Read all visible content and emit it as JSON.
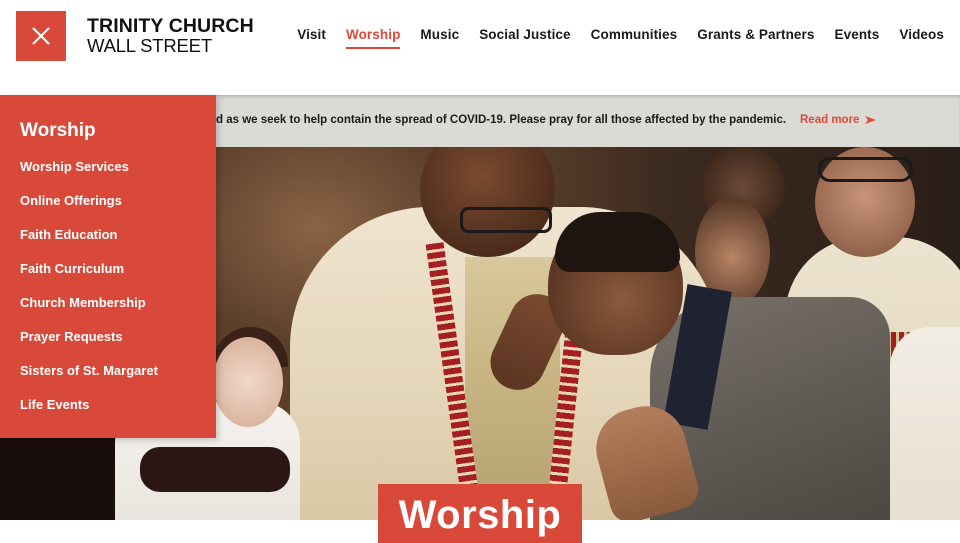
{
  "header": {
    "menu_close_icon": "close-icon",
    "logo": {
      "line1": "TRINITY CHURCH",
      "line2": "WALL STREET"
    },
    "nav": [
      {
        "label": "Visit",
        "active": false
      },
      {
        "label": "Worship",
        "active": true
      },
      {
        "label": "Music",
        "active": false
      },
      {
        "label": "Social Justice",
        "active": false
      },
      {
        "label": "Communities",
        "active": false
      },
      {
        "label": "Grants & Partners",
        "active": false
      },
      {
        "label": "Events",
        "active": false
      },
      {
        "label": "Videos",
        "active": false
      }
    ]
  },
  "alert": {
    "text": "d as we seek to help contain the spread of COVID-19. Please pray for all those affected by the pandemic.",
    "link_label": "Read more",
    "link_icon": "arrow-right-icon"
  },
  "dropdown": {
    "title": "Worship",
    "items": [
      {
        "label": "Worship Services"
      },
      {
        "label": "Online Offerings"
      },
      {
        "label": "Faith Education"
      },
      {
        "label": "Faith Curriculum"
      },
      {
        "label": "Church Membership"
      },
      {
        "label": "Prayer Requests"
      },
      {
        "label": "Sisters of St. Margaret"
      },
      {
        "label": "Life Events"
      }
    ]
  },
  "hero": {
    "image_description": "Clergy blessing a congregant during worship service",
    "title": "Worship"
  },
  "colors": {
    "accent": "#d9493a",
    "alert_bg": "#dcdad5",
    "text": "#1a1a1a"
  }
}
